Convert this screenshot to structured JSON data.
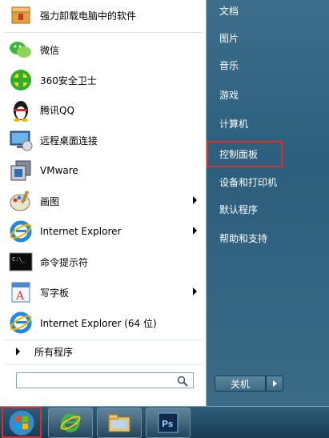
{
  "left_panel": {
    "items": [
      {
        "label": "强力卸载电脑中的软件",
        "icon": "uninstall-box-icon",
        "has_arrow": false
      },
      {
        "label": "微信",
        "icon": "wechat-icon",
        "has_arrow": false
      },
      {
        "label": "360安全卫士",
        "icon": "360-security-icon",
        "has_arrow": false
      },
      {
        "label": "腾讯QQ",
        "icon": "qq-penguin-icon",
        "has_arrow": false
      },
      {
        "label": "远程桌面连接",
        "icon": "remote-desktop-icon",
        "has_arrow": false
      },
      {
        "label": "VMware",
        "icon": "vmware-icon",
        "has_arrow": false
      },
      {
        "label": "画图",
        "icon": "paint-icon",
        "has_arrow": true
      },
      {
        "label": "Internet Explorer",
        "icon": "internet-explorer-icon",
        "has_arrow": true
      },
      {
        "label": "命令提示符",
        "icon": "command-prompt-icon",
        "has_arrow": false
      },
      {
        "label": "写字板",
        "icon": "wordpad-icon",
        "has_arrow": true
      },
      {
        "label": "Internet Explorer (64 位)",
        "icon": "internet-explorer-icon",
        "has_arrow": false
      }
    ],
    "all_programs": "所有程序",
    "search_placeholder": ""
  },
  "right_panel": {
    "items": [
      "文档",
      "图片",
      "音乐",
      "游戏",
      "计算机",
      "控制面板",
      "设备和打印机",
      "默认程序",
      "帮助和支持"
    ],
    "highlighted": "控制面板",
    "shutdown_label": "关机"
  },
  "taskbar": {
    "buttons": [
      "windows-start-orb-icon",
      "internet-explorer-icon",
      "windows-explorer-folder-icon",
      "photoshop-icon"
    ]
  },
  "colors": {
    "highlight_border": "#e02b2b",
    "right_panel": "#2c5e7d",
    "taskbar": "#173a52"
  }
}
